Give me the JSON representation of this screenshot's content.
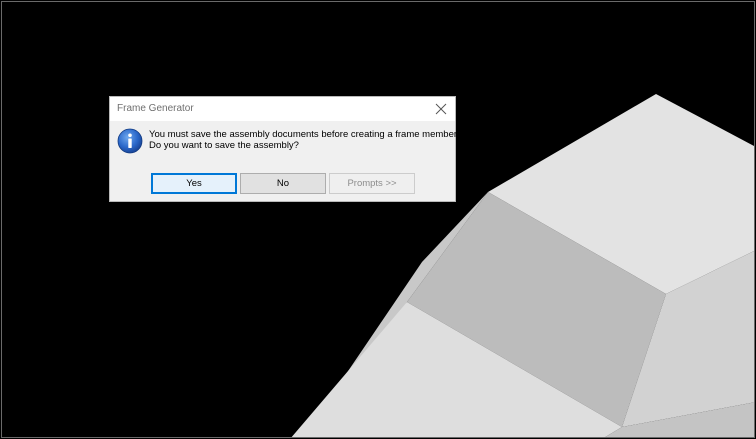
{
  "dialog": {
    "title": "Frame Generator",
    "message_line1": "You must save the assembly documents before creating a frame member.",
    "message_line2": "Do you want to save the assembly?",
    "buttons": {
      "yes": "Yes",
      "no": "No",
      "prompts": "Prompts >>"
    },
    "icon": "info-icon",
    "close_icon": "close-icon"
  },
  "colors": {
    "viewport_background": "#000000",
    "default_button_border": "#0078d7",
    "info_icon_blue": "#1f5fbf"
  }
}
